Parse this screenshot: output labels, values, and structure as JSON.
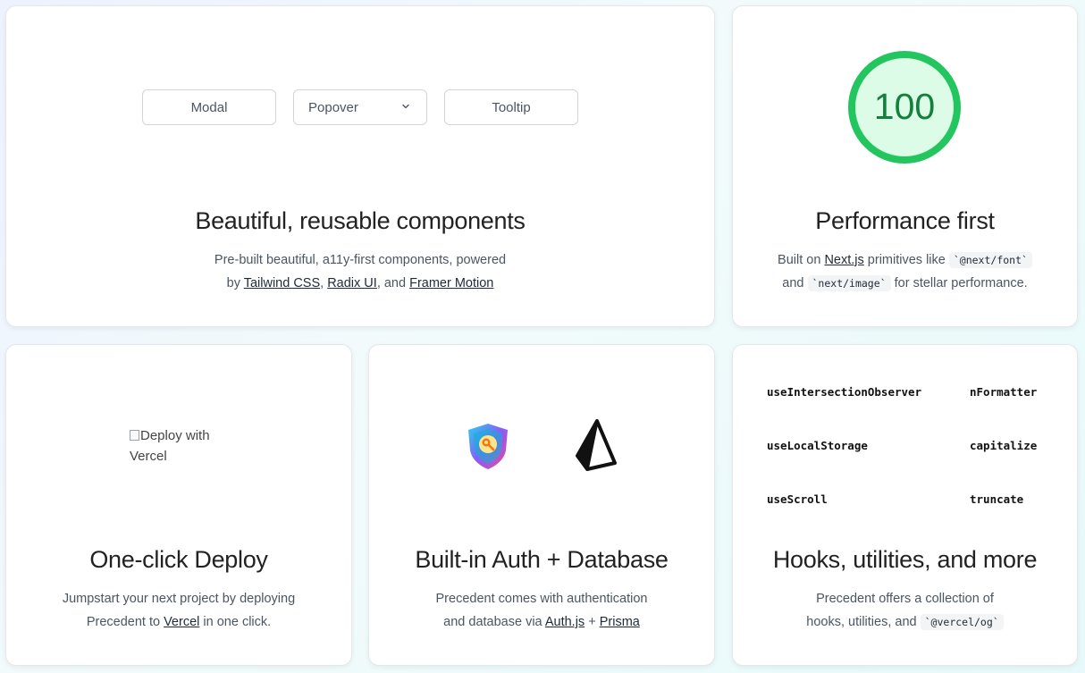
{
  "components_card": {
    "buttons": {
      "modal": "Modal",
      "popover": "Popover",
      "tooltip": "Tooltip"
    },
    "title": "Beautiful, reusable components",
    "desc_line1": "Pre-built beautiful, a11y-first components, powered",
    "desc_by": "by ",
    "link_tailwind": "Tailwind CSS",
    "sep1": ", ",
    "link_radix": "Radix UI",
    "sep2": ", and ",
    "link_framer": "Framer Motion"
  },
  "performance_card": {
    "score": "100",
    "score_color": "#22c55e",
    "score_fill": "#dcfce7",
    "title": "Performance first",
    "desc_built": "Built on ",
    "link_next": "Next.js",
    "desc_prims": " primitives like ",
    "code_font": "`@next/font`",
    "desc_and": "and ",
    "code_image": "`next/image`",
    "desc_stellar": " for stellar performance."
  },
  "deploy_card": {
    "image_alt": "Deploy with Vercel",
    "title": "One-click Deploy",
    "desc_line1": "Jumpstart your next project by deploying",
    "desc_pre": "Precedent to ",
    "link_vercel": "Vercel",
    "desc_post": " in one click."
  },
  "auth_card": {
    "icons": [
      "auth-shield-icon",
      "prisma-icon"
    ],
    "title": "Built-in Auth + Database",
    "desc_line1": "Precedent comes with authentication",
    "desc_pre": "and database via ",
    "link_auth": "Auth.js",
    "desc_plus": " + ",
    "link_prisma": "Prisma"
  },
  "hooks_card": {
    "hooks": [
      "useIntersectionObserver",
      "useLocalStorage",
      "useScroll"
    ],
    "utils": [
      "nFormatter",
      "capitalize",
      "truncate"
    ],
    "title": "Hooks, utilities, and more",
    "desc_line1": "Precedent offers a collection of",
    "desc_pre": "hooks, utilities, and ",
    "code_og": "`@vercel/og`"
  }
}
